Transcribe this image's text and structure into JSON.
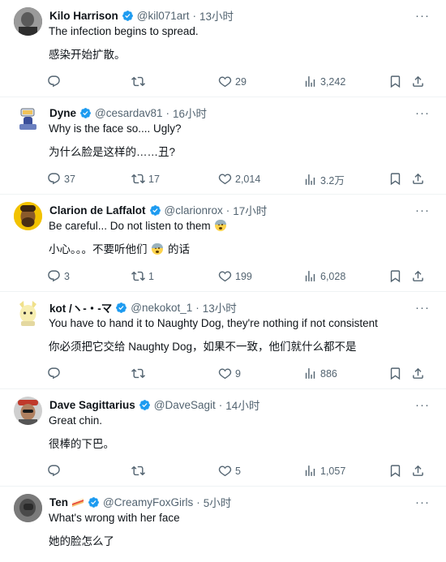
{
  "replies": [
    {
      "name": "Kilo Harrison",
      "handle": "@kil071art",
      "dot": "·",
      "time": "13小时",
      "text_en": "The infection begins to spread.",
      "text_zh": "感染开始扩散。",
      "stats": {
        "replies": "",
        "reposts": "",
        "likes": "29",
        "views": "3,242"
      }
    },
    {
      "name": "Dyne",
      "handle": "@cesardav81",
      "dot": "·",
      "time": "16小时",
      "text_en": "Why is the face so.... Ugly?",
      "text_zh": "为什么脸是这样的……丑?",
      "stats": {
        "replies": "37",
        "reposts": "17",
        "likes": "2,014",
        "views": "3.2万"
      }
    },
    {
      "name": "Clarion de Laffalot",
      "handle": "@clarionrox",
      "dot": "·",
      "time": "17小时",
      "text_en_before": "Be careful... Do not listen to them",
      "text_zh_before": "小心。。。不要听他们",
      "text_zh_after": "的话",
      "stats": {
        "replies": "3",
        "reposts": "1",
        "likes": "199",
        "views": "6,028"
      }
    },
    {
      "name": "kot /ヽ-・-マ",
      "handle": "@nekokot_1",
      "dot": "·",
      "time": "13小时",
      "text_en": "You have to hand it to Naughty Dog, they're nothing if not consistent",
      "text_zh": "你必须把它交给 Naughty Dog，如果不一致，他们就什么都不是",
      "stats": {
        "replies": "",
        "reposts": "",
        "likes": "9",
        "views": "886"
      }
    },
    {
      "name": "Dave Sagittarius",
      "handle": "@DaveSagit",
      "dot": "·",
      "time": "14小时",
      "text_en": "Great chin.",
      "text_zh": "很棒的下巴。",
      "stats": {
        "replies": "",
        "reposts": "",
        "likes": "5",
        "views": "1,057"
      }
    },
    {
      "name": "Ten",
      "handle": "@CreamyFoxGirls",
      "dot": "·",
      "time": "5小时",
      "text_en": "What's wrong with her face",
      "text_zh": "她的脸怎么了"
    }
  ],
  "colors": {
    "verified": "#1d9bf0",
    "muted": "#536471",
    "text": "#0f1419",
    "divider": "#eff3f4"
  },
  "icons": [
    "more-icon",
    "reply-icon",
    "repost-icon",
    "like-icon",
    "views-icon",
    "bookmark-icon",
    "share-icon",
    "verified-badge-icon"
  ]
}
